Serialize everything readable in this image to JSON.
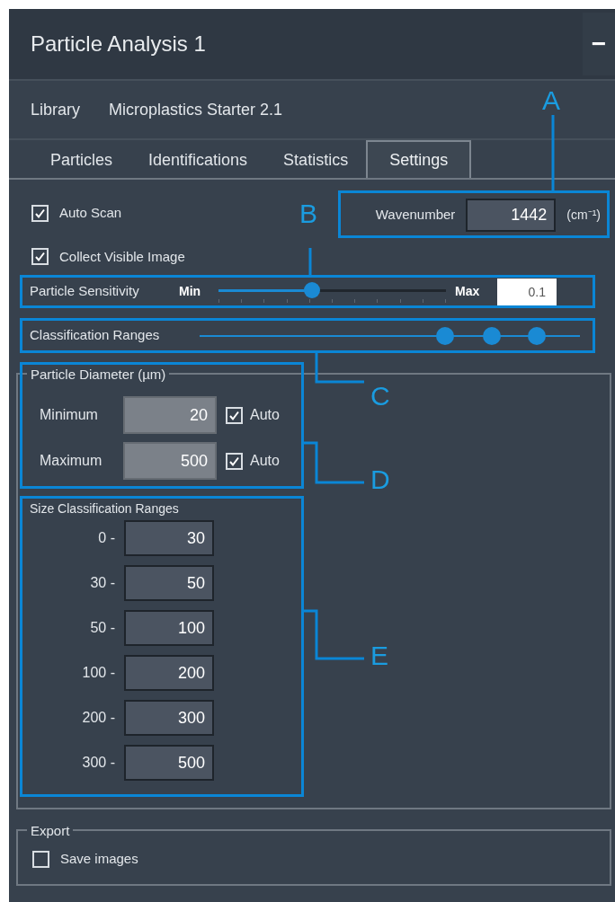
{
  "title": "Particle Analysis 1",
  "collapse_button": "−",
  "library": {
    "label": "Library",
    "value": "Microplastics Starter 2.1"
  },
  "tabs": [
    {
      "label": "Particles",
      "selected": false
    },
    {
      "label": "Identifications",
      "selected": false
    },
    {
      "label": "Statistics",
      "selected": false
    },
    {
      "label": "Settings",
      "selected": true
    }
  ],
  "options": [
    {
      "label": "Auto Scan",
      "checked": true
    },
    {
      "label": "Collect Visible Image",
      "checked": true
    }
  ],
  "wavenumber": {
    "label": "Wavenumber",
    "value": "1442",
    "unit": "(cm⁻¹)"
  },
  "particle_sensitivity": {
    "label": "Particle Sensitivity",
    "min_label": "Min",
    "max_label": "Max",
    "level": 0.41,
    "value": "0.1"
  },
  "classification_ranges": {
    "label": "Classification Ranges",
    "thumbs": [
      {
        "level": 0.645
      },
      {
        "level": 0.768
      },
      {
        "level": 0.887
      }
    ]
  },
  "particle_diameter": {
    "title": "Particle Diameter (µm)",
    "rows": [
      {
        "label": "Minimum",
        "value": "20",
        "auto_label": "Auto",
        "auto": true
      },
      {
        "label": "Maximum",
        "value": "500",
        "auto_label": "Auto",
        "auto": true
      }
    ]
  },
  "size_classification": {
    "title": "Size Classification Ranges",
    "rows": [
      {
        "from": "0 -",
        "to": "30"
      },
      {
        "from": "30 -",
        "to": "50"
      },
      {
        "from": "50 -",
        "to": "100"
      },
      {
        "from": "100 -",
        "to": "200"
      },
      {
        "from": "200 -",
        "to": "300"
      },
      {
        "from": "300 -",
        "to": "500"
      }
    ]
  },
  "export": {
    "title": "Export",
    "options": [
      {
        "label": "Save images",
        "checked": false
      }
    ]
  },
  "callouts": [
    {
      "label": "A"
    },
    {
      "label": "B"
    },
    {
      "label": "C"
    },
    {
      "label": "D"
    },
    {
      "label": "E"
    }
  ]
}
